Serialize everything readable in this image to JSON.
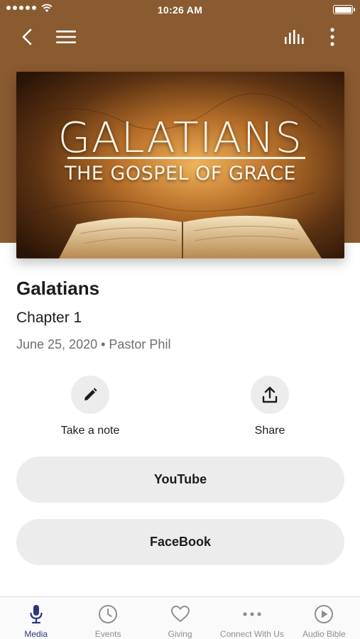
{
  "status_bar": {
    "time": "10:26 AM"
  },
  "artwork": {
    "title": "GALATIANS",
    "subtitle": "THE GOSPEL OF GRACE"
  },
  "sermon": {
    "title": "Galatians",
    "subtitle": "Chapter 1",
    "meta": "June 25, 2020 • Pastor Phil"
  },
  "actions": [
    {
      "label": "Take a note",
      "icon": "pencil-icon"
    },
    {
      "label": "Share",
      "icon": "share-icon"
    }
  ],
  "links": [
    {
      "label": "YouTube"
    },
    {
      "label": "FaceBook"
    }
  ],
  "tabs": [
    {
      "label": "Media",
      "icon": "microphone-icon",
      "active": true
    },
    {
      "label": "Events",
      "icon": "clock-icon"
    },
    {
      "label": "Giving",
      "icon": "heart-icon"
    },
    {
      "label": "Connect With Us",
      "icon": "more-dots-icon"
    },
    {
      "label": "Audio Bible",
      "icon": "play-circle-icon"
    }
  ],
  "colors": {
    "header": "#8a5a30",
    "active_tab": "#2c3580",
    "button_bg": "#ececec"
  }
}
